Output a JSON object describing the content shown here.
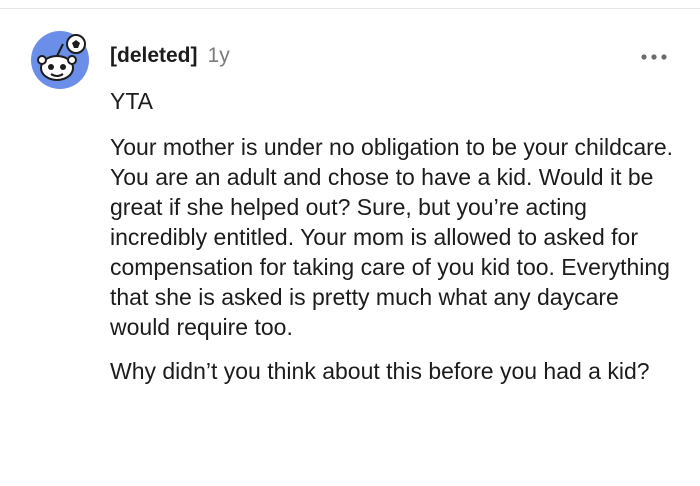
{
  "comment": {
    "author": "[deleted]",
    "age": "1y",
    "paragraphs": [
      "YTA",
      "Your mother is under no obligation to be your childcare. You are an adult and chose to have a kid. Would it be great if she helped out? Sure, but you’re acting incredibly entitled. Your mom is allowed to asked for compensation for taking care of you kid too. Everything that she is asked is pretty much what any daycare would require too.",
      "Why didn’t you think about this before you had a kid?"
    ]
  },
  "icons": {
    "avatar": "snoo-avatar-icon",
    "more": "more-options-icon"
  },
  "colors": {
    "avatar_bg": "#6b8fe8",
    "text": "#1c1c1c",
    "muted": "#7c7c7c"
  }
}
